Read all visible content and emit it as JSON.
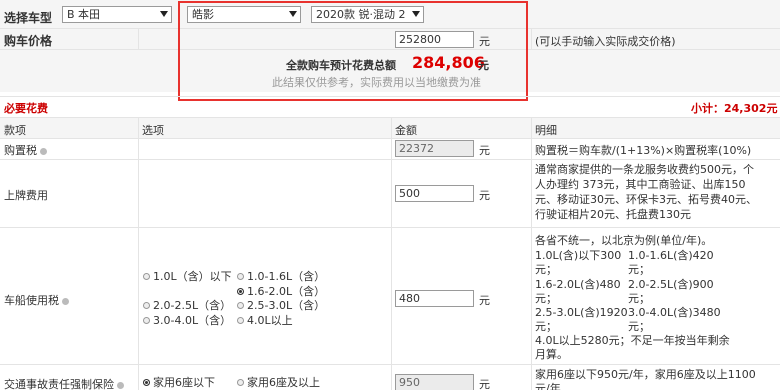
{
  "filter": {
    "label": "选择车型",
    "brand": "B 本田",
    "model": "皓影",
    "trim": "2020款 锐·混动 2"
  },
  "price_row": {
    "label": "购车价格",
    "value": "252800",
    "unit": "元",
    "hint": "(可以手动输入实际成交价格)"
  },
  "total": {
    "label": "全款购车预计花费总额",
    "amount": "284,806",
    "unit": "元",
    "note": "此结果仅供参考，实际费用以当地缴费为准"
  },
  "required": {
    "title": "必要花费",
    "subtotal": "小计：24,302元"
  },
  "headers": {
    "item": "款项",
    "option": "选项",
    "amount": "金额",
    "detail": "明细"
  },
  "rows": {
    "purchase_tax": {
      "name": "购置税",
      "value": "22372",
      "unit": "元",
      "detail": "购置税＝购车款/(1+13%)×购置税率(10%)"
    },
    "plate_fee": {
      "name": "上牌费用",
      "value": "500",
      "unit": "元",
      "detail_lines": [
        "通常商家提供的一条龙服务收费约500元，个",
        "人办理约 373元，其中工商验证、出库150",
        "元、移动证30元、环保卡3元、拓号费40元、",
        "行驶证相片20元、托盘费130元"
      ]
    },
    "vehicle_tax": {
      "name": "车船使用税",
      "value": "480",
      "unit": "元",
      "options": [
        {
          "label": "1.0L（含）以下",
          "selected": false
        },
        {
          "label": "1.0-1.6L（含）",
          "selected": false
        },
        {
          "label": "1.6-2.0L（含）",
          "selected": true
        },
        {
          "label": "2.0-2.5L（含）",
          "selected": false
        },
        {
          "label": "2.5-3.0L（含）",
          "selected": false
        },
        {
          "label": "3.0-4.0L（含）",
          "selected": false
        },
        {
          "label": "4.0L以上",
          "selected": false
        }
      ],
      "detail_intro": "各省不统一，以北京为例(单位/年)。",
      "detail_left": [
        "1.0L(含)以下300",
        "元；",
        "1.6-2.0L(含)480",
        "元；",
        "2.5-3.0L(含)1920",
        "元；"
      ],
      "detail_right": [
        "1.0-1.6L(含)420",
        "元；",
        "2.0-2.5L(含)900",
        "元；",
        "3.0-4.0L(含)3480",
        "元；"
      ],
      "detail_tail": [
        "4.0L以上5280元；不足一年按当年剩余",
        "月算。"
      ]
    },
    "insurance": {
      "name": "交通事故责任强制保险",
      "value": "950",
      "unit": "元",
      "options": [
        {
          "label": "家用6座以下",
          "selected": true
        },
        {
          "label": "家用6座及以上",
          "selected": false
        }
      ],
      "detail_lines": [
        "家用6座以下950元/年，家用6座及以上1100",
        "元/年"
      ]
    }
  }
}
